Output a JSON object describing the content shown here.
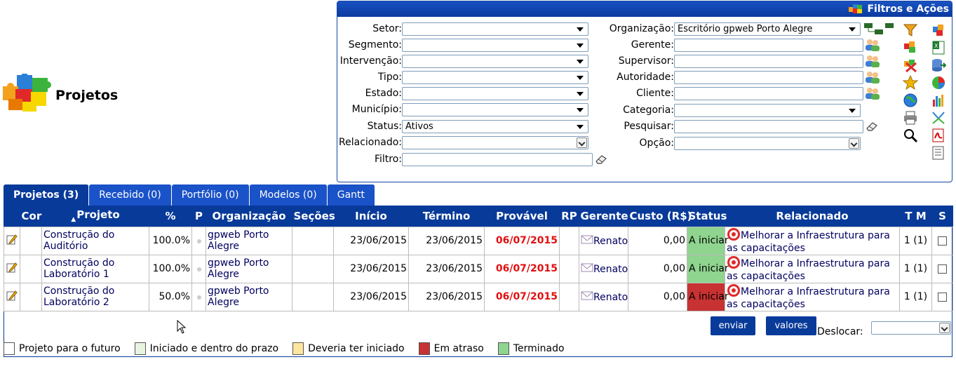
{
  "page": {
    "title": "Projetos"
  },
  "filters": {
    "header": "Filtros e Ações",
    "left": [
      {
        "label": "Setor:",
        "value": "",
        "kind": "select"
      },
      {
        "label": "Segmento:",
        "value": "",
        "kind": "select"
      },
      {
        "label": "Intervenção:",
        "value": "",
        "kind": "select"
      },
      {
        "label": "Tipo:",
        "value": "",
        "kind": "select"
      },
      {
        "label": "Estado:",
        "value": "",
        "kind": "select"
      },
      {
        "label": "Município:",
        "value": "",
        "kind": "select"
      },
      {
        "label": "Status:",
        "value": "Ativos",
        "kind": "select"
      },
      {
        "label": "Relacionado:",
        "value": "",
        "kind": "select-boxed"
      },
      {
        "label": "Filtro:",
        "value": "",
        "kind": "input"
      }
    ],
    "right": [
      {
        "label": "Organização:",
        "value": "Escritório gpweb Porto Alegre",
        "kind": "select"
      },
      {
        "label": "Gerente:",
        "value": "",
        "kind": "input"
      },
      {
        "label": "Supervisor:",
        "value": "",
        "kind": "input"
      },
      {
        "label": "Autoridade:",
        "value": "",
        "kind": "input"
      },
      {
        "label": "Cliente:",
        "value": "",
        "kind": "input"
      },
      {
        "label": "Categoria:",
        "value": "",
        "kind": "select"
      },
      {
        "label": "Pesquisar:",
        "value": "",
        "kind": "input"
      },
      {
        "label": "Opção:",
        "value": "",
        "kind": "select-boxed"
      }
    ]
  },
  "tabs": [
    {
      "label": "Projetos (3)",
      "active": true
    },
    {
      "label": "Recebido (0)",
      "active": false
    },
    {
      "label": "Portfólio (0)",
      "active": false
    },
    {
      "label": "Modelos (0)",
      "active": false
    },
    {
      "label": "Gantt",
      "active": false
    }
  ],
  "table": {
    "headers": {
      "cor": "Cor",
      "projeto": "Projeto",
      "pct": "%",
      "p": "P",
      "organizacao": "Organização",
      "secoes": "Seções",
      "inicio": "Início",
      "termino": "Término",
      "provavel": "Provável",
      "rp": "RP",
      "gerente": "Gerente",
      "custo": "Custo (R$)",
      "status": "Status",
      "relacionado": "Relacionado",
      "tm": "T M",
      "s": "S"
    },
    "rows": [
      {
        "projeto_l1": "Construção do",
        "projeto_l2": "Auditório",
        "pct": "100.0%",
        "org_l1": "gpweb Porto",
        "org_l2": "Alegre",
        "inicio": "23/06/2015",
        "termino": "23/06/2015",
        "provavel": "06/07/2015",
        "gerente": "Renato",
        "custo": "0,00",
        "status": "A iniciar",
        "status_color": "#8fd48f",
        "rel_l1": "Melhorar a Infraestrutura para",
        "rel_l2": "as capacitações",
        "tm": "1 (1)"
      },
      {
        "projeto_l1": "Construção do",
        "projeto_l2": "Laboratório 1",
        "pct": "100.0%",
        "org_l1": "gpweb Porto",
        "org_l2": "Alegre",
        "inicio": "23/06/2015",
        "termino": "23/06/2015",
        "provavel": "06/07/2015",
        "gerente": "Renato",
        "custo": "0,00",
        "status": "A iniciar",
        "status_color": "#8fd48f",
        "rel_l1": "Melhorar a Infraestrutura para",
        "rel_l2": "as capacitações",
        "tm": "1 (1)"
      },
      {
        "projeto_l1": "Construção do",
        "projeto_l2": "Laboratório 2",
        "pct": "50.0%",
        "org_l1": "gpweb Porto",
        "org_l2": "Alegre",
        "inicio": "23/06/2015",
        "termino": "23/06/2015",
        "provavel": "06/07/2015",
        "gerente": "Renato",
        "custo": "0,00",
        "status": "A iniciar",
        "status_color": "#c83232",
        "rel_l1": "Melhorar a Infraestrutura para",
        "rel_l2": "as capacitações",
        "tm": "1 (1)"
      }
    ]
  },
  "actions": {
    "enviar": "enviar",
    "valores": "valores",
    "deslocar_label": "Deslocar:",
    "deslocar_value": ""
  },
  "legend": [
    {
      "label": "Projeto para o futuro",
      "color": "#ffffff"
    },
    {
      "label": "Iniciado e dentro do prazo",
      "color": "#e8f4e0"
    },
    {
      "label": "Deveria ter iniciado",
      "color": "#ffe6a0"
    },
    {
      "label": "Em atraso",
      "color": "#c83232"
    },
    {
      "label": "Terminado",
      "color": "#8fd48f"
    }
  ],
  "colors": {
    "header_blue": "#083a9a",
    "tab_blue": "#1a52c8",
    "late_red": "#e01010"
  }
}
